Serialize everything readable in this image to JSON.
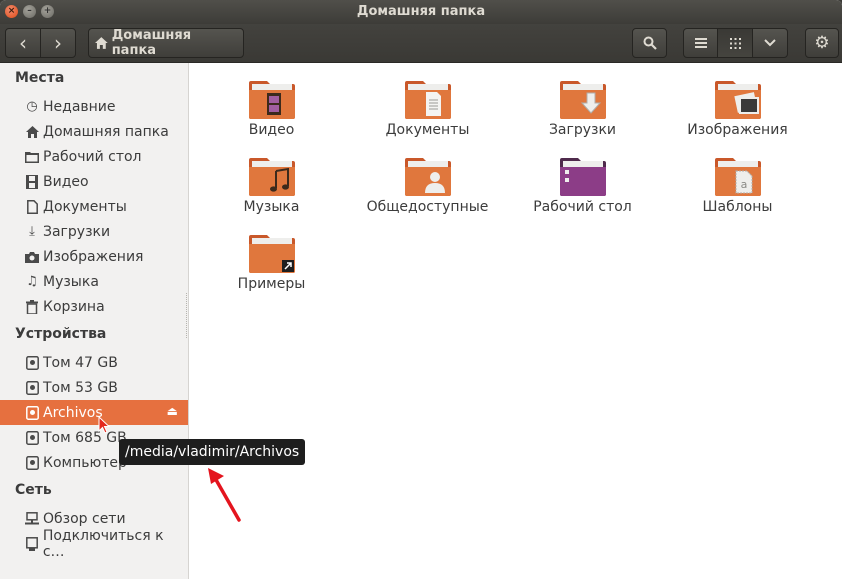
{
  "window": {
    "title": "Домашняя папка"
  },
  "toolbar": {
    "back": "‹",
    "forward": "›",
    "crumb_label": "Домашняя папка"
  },
  "sidebar": {
    "places_heading": "Места",
    "places": [
      {
        "label": "Недавние",
        "icon": "clock-icon"
      },
      {
        "label": "Домашняя папка",
        "icon": "home-icon"
      },
      {
        "label": "Рабочий стол",
        "icon": "folder-icon"
      },
      {
        "label": "Видео",
        "icon": "film-icon"
      },
      {
        "label": "Документы",
        "icon": "document-icon"
      },
      {
        "label": "Загрузки",
        "icon": "download-icon"
      },
      {
        "label": "Изображения",
        "icon": "camera-icon"
      },
      {
        "label": "Музыка",
        "icon": "music-icon"
      },
      {
        "label": "Корзина",
        "icon": "trash-icon"
      }
    ],
    "devices_heading": "Устройства",
    "devices": [
      {
        "label": "Том 47 GB",
        "icon": "drive-icon"
      },
      {
        "label": "Том 53 GB",
        "icon": "drive-icon"
      },
      {
        "label": "Archivos",
        "icon": "drive-icon",
        "selected": true
      },
      {
        "label": "Том 685 GB",
        "icon": "drive-icon"
      },
      {
        "label": "Компьютер",
        "icon": "drive-icon"
      }
    ],
    "network_heading": "Сеть",
    "network": [
      {
        "label": "Обзор сети",
        "icon": "network-icon"
      },
      {
        "label": "Подключиться к с…",
        "icon": "connect-icon"
      }
    ]
  },
  "files": [
    {
      "label": "Видео",
      "emblem": "film"
    },
    {
      "label": "Документы",
      "emblem": "doc"
    },
    {
      "label": "Загрузки",
      "emblem": "down"
    },
    {
      "label": "Изображения",
      "emblem": "pics"
    },
    {
      "label": "Музыка",
      "emblem": "music"
    },
    {
      "label": "Общедоступные",
      "emblem": "person"
    },
    {
      "label": "Рабочий стол",
      "emblem": "desktop"
    },
    {
      "label": "Шаблоны",
      "emblem": "template"
    },
    {
      "label": "Примеры",
      "emblem": "link"
    }
  ],
  "tooltip": {
    "text": "/media/vladimir/Archivos"
  },
  "colors": {
    "accent": "#e6703f",
    "folder": "#e0773d",
    "tooltip_bg": "#1e1e1e"
  }
}
